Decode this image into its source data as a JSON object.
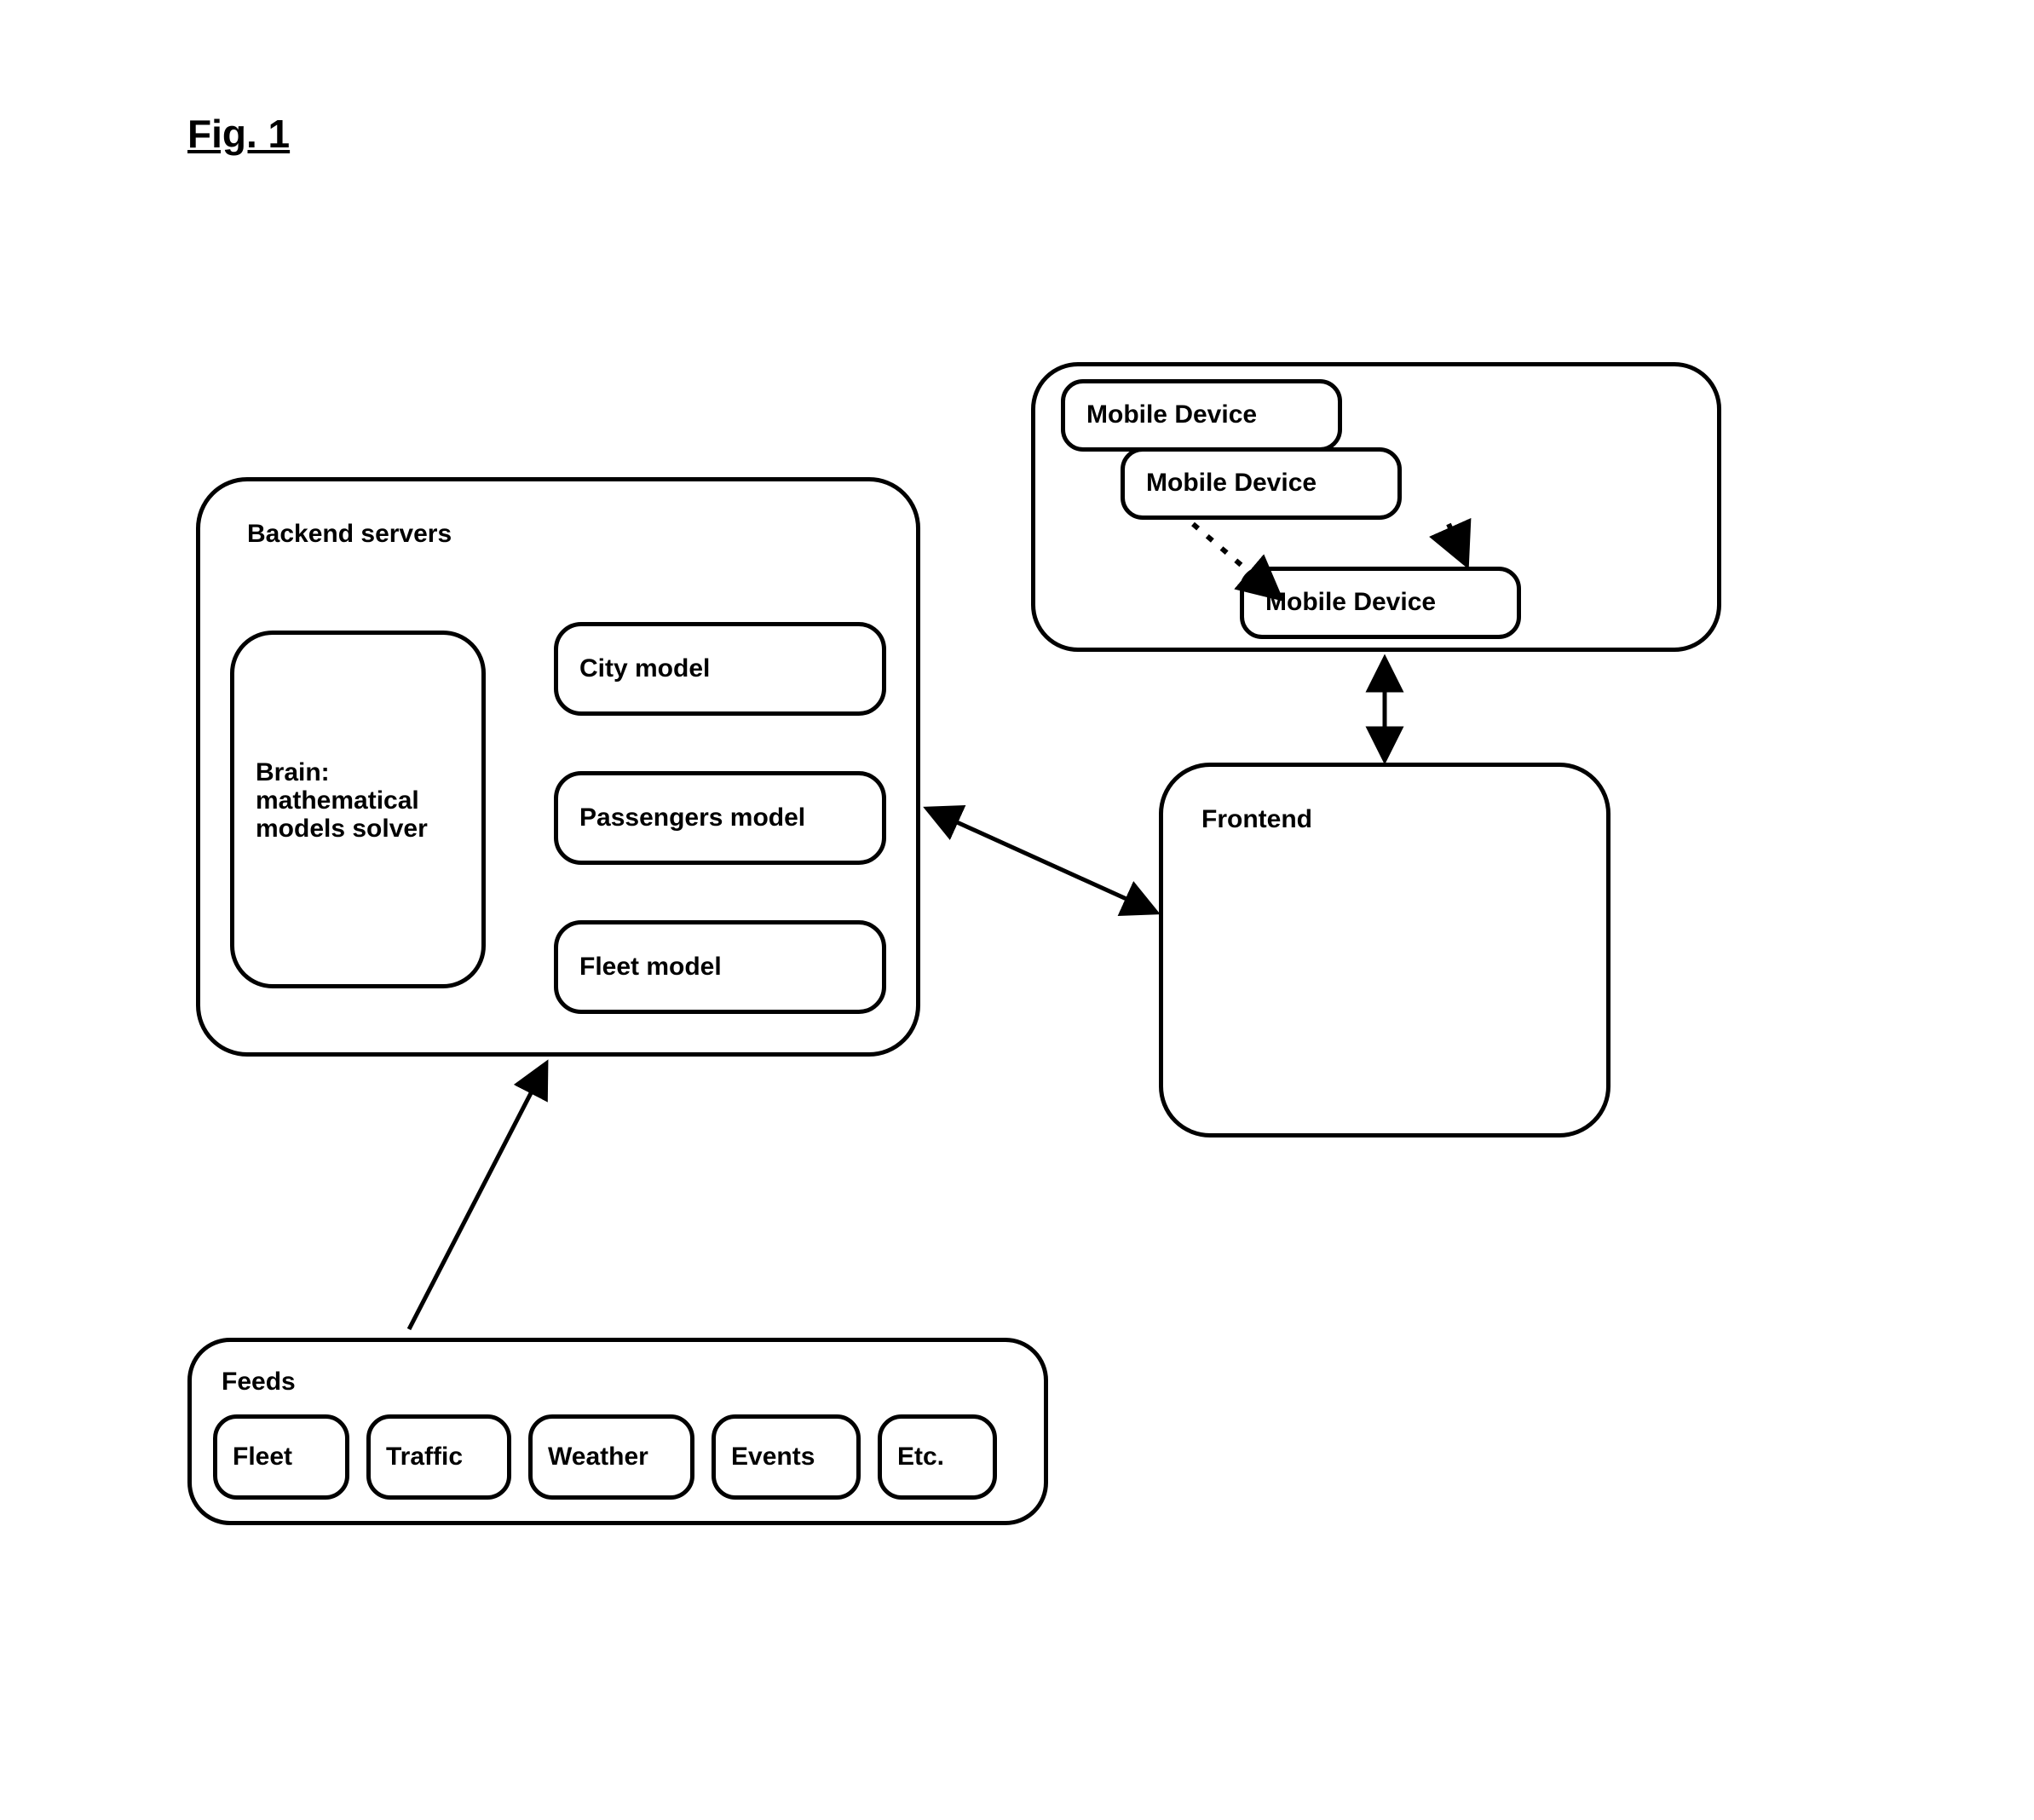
{
  "figure_title": "Fig. 1",
  "backend": {
    "title": "Backend servers",
    "brain_label": "Brain:\nmathematical\nmodels solver",
    "city_model": "City model",
    "passengers_model": "Passengers model",
    "fleet_model": "Fleet model"
  },
  "feeds": {
    "title": "Feeds",
    "items": [
      "Fleet",
      "Traffic",
      "Weather",
      "Events",
      "Etc."
    ]
  },
  "mobile": {
    "device_label": "Mobile Device"
  },
  "frontend": {
    "title": "Frontend"
  }
}
